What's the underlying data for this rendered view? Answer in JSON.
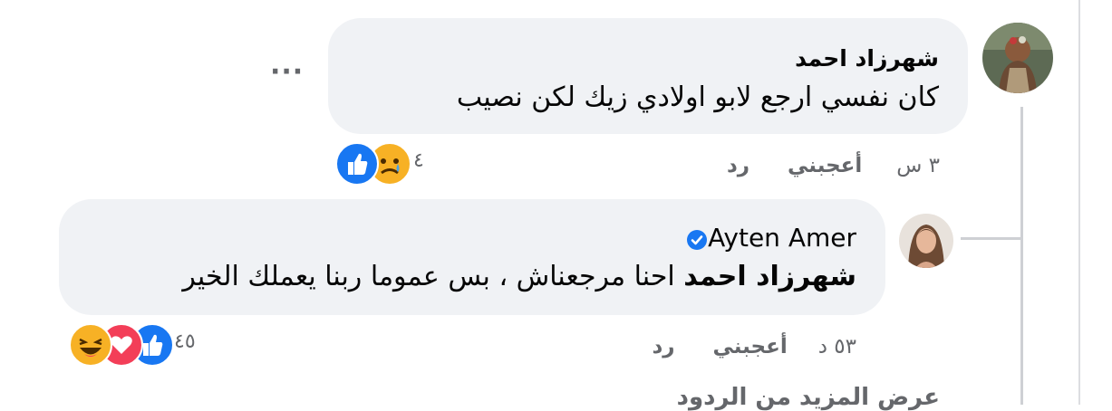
{
  "comments": [
    {
      "author": "شهرزاد احمد",
      "text": "كان نفسي ارجع لابو اولادي زيك لكن نصيب",
      "more_icon": "more-horizontal-icon",
      "actions": {
        "like": "أعجبني",
        "reply": "رد",
        "time": "٣ س"
      },
      "reactions": {
        "icons": [
          "like-icon",
          "sad-icon"
        ],
        "count": "٤"
      }
    },
    {
      "author": "Ayten Amer",
      "verified_icon": "verified-badge-icon",
      "mention": "شهرزاد احمد",
      "text": "احنا مرجعناش ، بس عموما ربنا يعملك الخير",
      "actions": {
        "like": "أعجبني",
        "reply": "رد",
        "time": "٥٣ د"
      },
      "reactions": {
        "icons": [
          "like-icon",
          "love-icon",
          "haha-icon"
        ],
        "count": "٤٥"
      }
    }
  ],
  "more_replies": "عرض المزيد من الردود",
  "colors": {
    "bubble": "#f0f2f5",
    "meta": "#65676b",
    "like": "#1877f2",
    "love": "#f33e58",
    "haha": "#f7b125",
    "thread": "#ced0d4"
  }
}
